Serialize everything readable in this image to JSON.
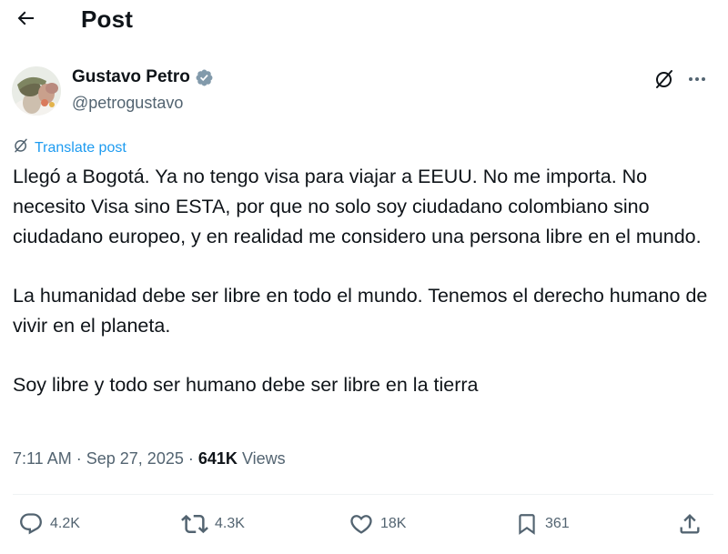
{
  "header": {
    "title": "Post",
    "back_icon": "arrow-left-icon"
  },
  "author": {
    "name": "Gustavo Petro",
    "handle": "@petrogustavo",
    "verified_color": "#829aab"
  },
  "translate": {
    "label": "Translate post"
  },
  "post": {
    "paragraphs": [
      "Llegó a Bogotá. Ya no tengo visa para viajar a EEUU. No me importa. No necesito Visa sino ESTA, por que no solo soy ciudadano colombiano sino ciudadano europeo, y en realidad me considero una persona libre en el mundo.",
      "La humanidad debe ser libre en todo el mundo. Tenemos el derecho humano de vivir en el planeta.",
      "Soy libre y todo ser humano debe ser libre en la tierra"
    ]
  },
  "meta": {
    "time": "7:11 AM",
    "separator": "·",
    "date": "Sep 27, 2025",
    "views_count": "641K",
    "views_label": "Views"
  },
  "actions": {
    "replies": "4.2K",
    "reposts": "4.3K",
    "likes": "18K",
    "bookmarks": "361"
  },
  "colors": {
    "text": "#0f1419",
    "secondary": "#536471",
    "accent": "#1d9bf0",
    "divider": "#eff3f4"
  }
}
